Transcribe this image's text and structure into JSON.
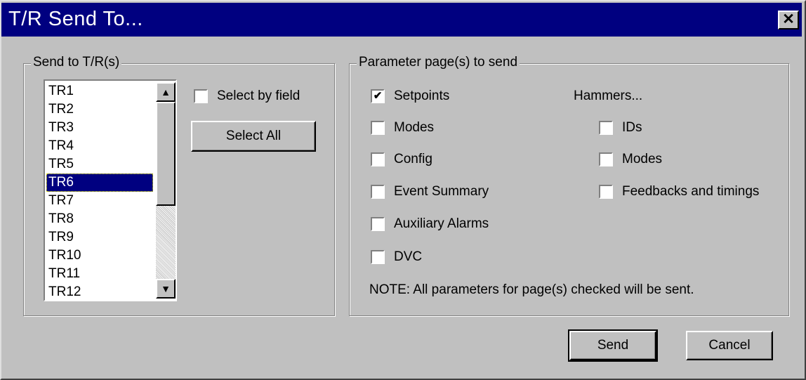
{
  "window": {
    "title": "T/R Send To...",
    "close_glyph": "✕"
  },
  "send_group": {
    "label": "Send to T/R(s)",
    "items": [
      "TR1",
      "TR2",
      "TR3",
      "TR4",
      "TR5",
      "TR6",
      "TR7",
      "TR8",
      "TR9",
      "TR10",
      "TR11",
      "TR12"
    ],
    "selected_item": "TR6",
    "scroll_up_glyph": "▲",
    "scroll_down_glyph": "▼",
    "select_by_field": {
      "label": "Select by field",
      "checked": false
    },
    "select_all_label": "Select All"
  },
  "param_group": {
    "label": "Parameter page(s) to send",
    "pages": [
      {
        "label": "Setpoints",
        "checked": true
      },
      {
        "label": "Modes",
        "checked": false
      },
      {
        "label": "Config",
        "checked": false
      },
      {
        "label": "Event Summary",
        "checked": false
      },
      {
        "label": "Auxiliary Alarms",
        "checked": false
      },
      {
        "label": "DVC",
        "checked": false
      }
    ],
    "hammers_label": "Hammers...",
    "hammers": [
      {
        "label": "IDs",
        "checked": false
      },
      {
        "label": "Modes",
        "checked": false
      },
      {
        "label": "Feedbacks and timings",
        "checked": false
      }
    ],
    "note": "NOTE: All parameters for page(s) checked will be sent.",
    "check_glyph": "✔"
  },
  "buttons": {
    "send": "Send",
    "cancel": "Cancel"
  }
}
